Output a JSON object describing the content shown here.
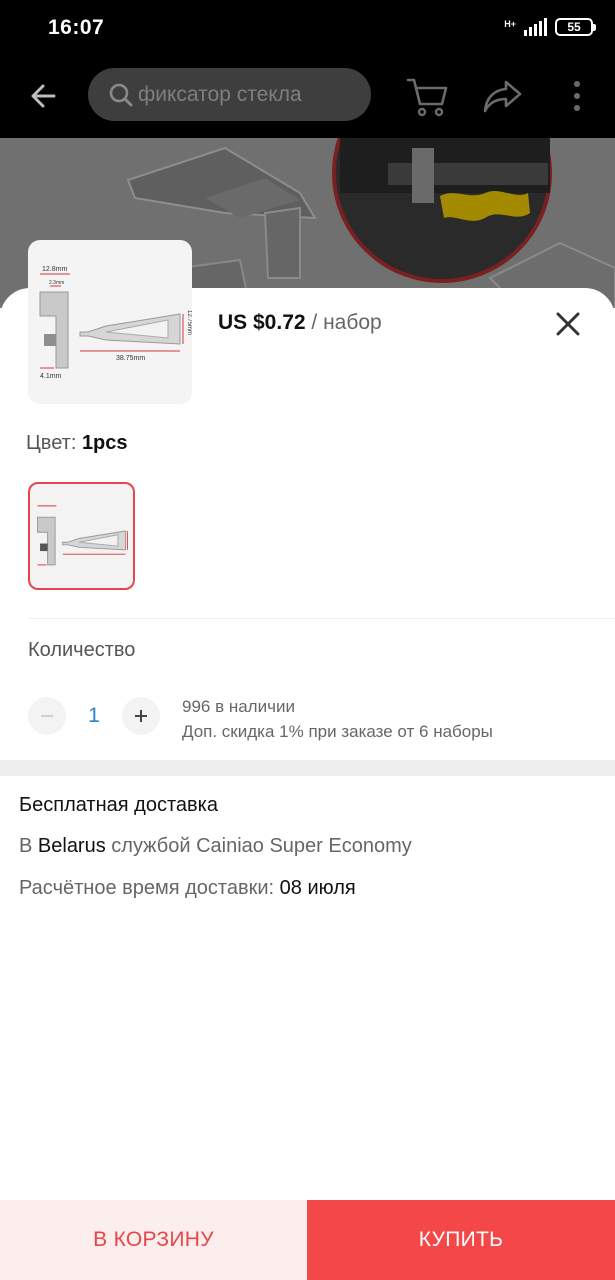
{
  "status_bar": {
    "time": "16:07",
    "network": "H+",
    "battery": "55"
  },
  "header": {
    "search_text": "фиксатор стекла",
    "icons": [
      "back-arrow-icon",
      "search-icon",
      "cart-icon",
      "share-icon",
      "more-vertical-icon"
    ]
  },
  "product": {
    "price": "US $0.72",
    "unit": " / набор",
    "dimensions": [
      "12.8mm",
      "2.3mm",
      "4.1mm",
      "38.75mm",
      "12.75mm"
    ]
  },
  "color": {
    "label": "Цвет: ",
    "value": "1pcs"
  },
  "quantity": {
    "label": "Количество",
    "value": "1",
    "minus": "−",
    "plus": "+",
    "stock": "996 в наличии",
    "discount": "Доп. скидка 1% при заказе от 6 наборы"
  },
  "shipping": {
    "title": "Бесплатная доставка",
    "to_prefix": "В ",
    "country": "Belarus",
    "service": " службой Cainiao Super Economy",
    "eta_label": "Расчётное время доставки: ",
    "eta_date": "08 июля"
  },
  "actions": {
    "add_to_cart": "В КОРЗИНУ",
    "buy": "КУПИТЬ"
  },
  "colors": {
    "accent": "#f44848",
    "accent_light": "#fdeeee",
    "variant_border": "#e8454a",
    "link_blue": "#2a86c8"
  }
}
